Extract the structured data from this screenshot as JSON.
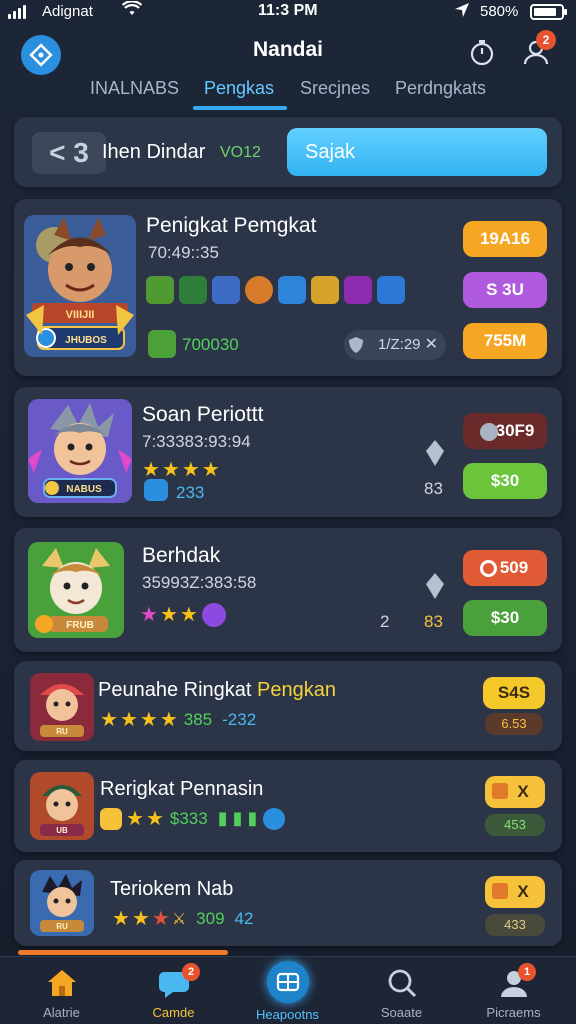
{
  "status_bar": {
    "carrier": "Adignat",
    "time": "11:3 PM",
    "battery": "580%"
  },
  "header": {
    "title": "Nandai",
    "notification_count": "2"
  },
  "tabs": [
    {
      "label": "INALNABS"
    },
    {
      "label": "Pengkas"
    },
    {
      "label": "Srecjnes"
    },
    {
      "label": "Perdngkats"
    }
  ],
  "search_panel": {
    "back_label": "< 3",
    "label": "Ihen Dindar",
    "accent": "VO12",
    "search_label": "Sajak"
  },
  "cards": [
    {
      "title": "Penigkat Pemgkat",
      "code": "70:49::35",
      "bottom_value": "700030",
      "meta": "1/Z:29",
      "badges": [
        "19A16",
        "S 3U",
        "755M"
      ],
      "avatar_banner": "VIIIJII",
      "avatar_plate": "JHUBOS"
    },
    {
      "title": "Soan Periottt",
      "code": "7:33383:93:94",
      "level": "233",
      "side_num": "83",
      "badges": [
        "30F9",
        "$30"
      ],
      "avatar_plate": "NABUS"
    },
    {
      "title": "Berhdak",
      "code": "35993Z:383:58",
      "num_a": "2",
      "num_b": "83",
      "badges": [
        "509",
        "$30"
      ],
      "avatar_plate": "FRUB"
    },
    {
      "title": "Peunahe Ringkat",
      "title_accent": "Pengkan",
      "stat_a": "385",
      "stat_b": "-232",
      "badges": [
        "S4S",
        "6.53"
      ],
      "avatar_plate": "RU"
    },
    {
      "title": "Rerigkat Pennasin",
      "stat": "$333",
      "badges": [
        "X",
        "453"
      ],
      "avatar_plate": "UB"
    },
    {
      "title": "Teriokem Nab",
      "stat_a": "309",
      "stat_b": "42",
      "badges": [
        "X",
        "433"
      ],
      "avatar_plate": "RU"
    }
  ],
  "bottom_nav": [
    {
      "label": "Alatrie"
    },
    {
      "label": "Camde",
      "badge": "2"
    },
    {
      "label": "Heapootns"
    },
    {
      "label": "Soaate"
    },
    {
      "label": "Picraems",
      "badge": "1"
    }
  ],
  "colors": {
    "accent": "#36a8f0",
    "orange": "#f5a623",
    "purple": "#b05ae0",
    "green": "#6cc43a",
    "red": "#e05a36"
  }
}
